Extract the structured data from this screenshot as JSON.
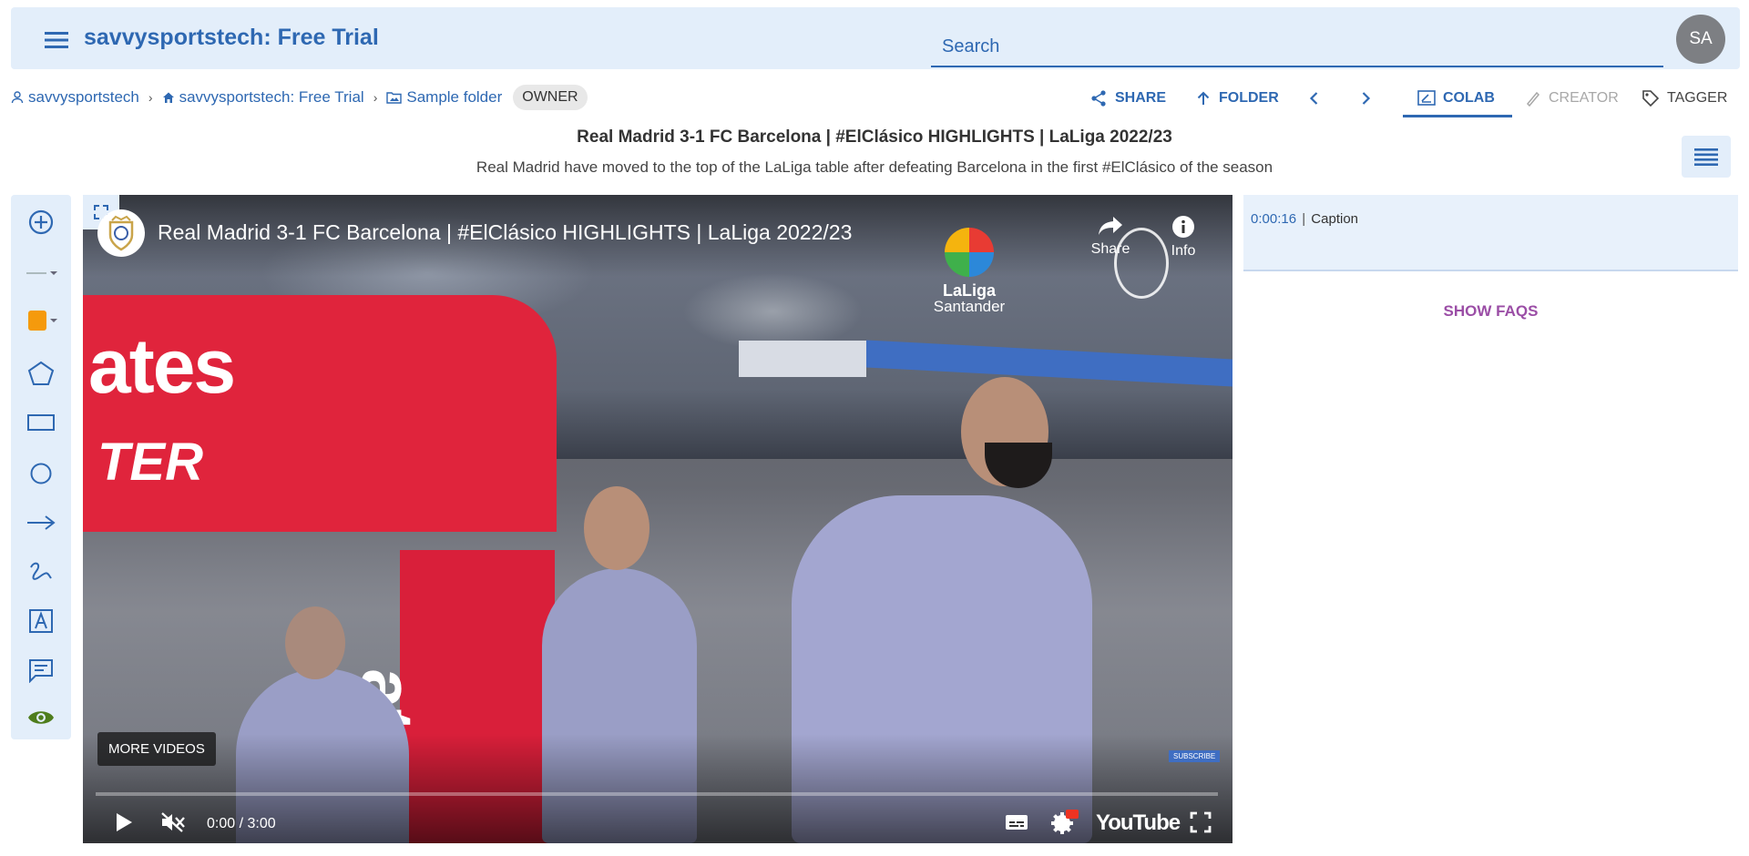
{
  "app": {
    "title": "savvysportstech: Free Trial",
    "search_placeholder": "Search",
    "avatar_initials": "SA"
  },
  "breadcrumb": {
    "items": [
      {
        "label": "savvysportstech",
        "icon": "person-icon"
      },
      {
        "label": "savvysportstech: Free Trial",
        "icon": "home-icon"
      },
      {
        "label": "Sample folder",
        "icon": "folder-image-icon"
      }
    ],
    "role_chip": "OWNER"
  },
  "actions": {
    "share": "SHARE",
    "folder": "FOLDER",
    "colab": "COLAB",
    "creator": "CREATOR",
    "tagger": "TAGGER"
  },
  "video_info": {
    "title": "Real Madrid 3-1 FC Barcelona | #ElClásico HIGHLIGHTS | LaLiga 2022/23",
    "description": "Real Madrid have moved to the top of the LaLiga table after defeating Barcelona in the first #ElClásico of the season"
  },
  "toolbar": {
    "tools": [
      "add-circle-icon",
      "line-style-icon",
      "color-swatch-icon",
      "pentagon-icon",
      "rectangle-icon",
      "circle-icon",
      "arrow-icon",
      "freehand-icon",
      "text-box-icon",
      "comment-icon",
      "eye-icon"
    ],
    "accent_color": "#f59a0c"
  },
  "player": {
    "overlay_title": "Real Madrid 3-1 FC Barcelona | #ElClásico HIGHLIGHTS | LaLiga 2022/23",
    "share_label": "Share",
    "info_label": "Info",
    "liga_line1": "LaLiga",
    "liga_line2": "Santander",
    "banner_text1": "ates",
    "banner_text2": "TER",
    "banner_text3": "ates",
    "more_videos": "MORE VIDEOS",
    "subscribe": "SUBSCRIBE",
    "time": "0:00 / 3:00",
    "youtube_label": "YouTube",
    "hd_badge": "HD",
    "progress": 0
  },
  "caption": {
    "time": "0:00:16",
    "separator": "|",
    "text": "Caption"
  },
  "faqs_label": "SHOW FAQS",
  "colors": {
    "brand": "#2e68b2",
    "panel": "#e3eefa",
    "faq": "#9b4ea6"
  }
}
